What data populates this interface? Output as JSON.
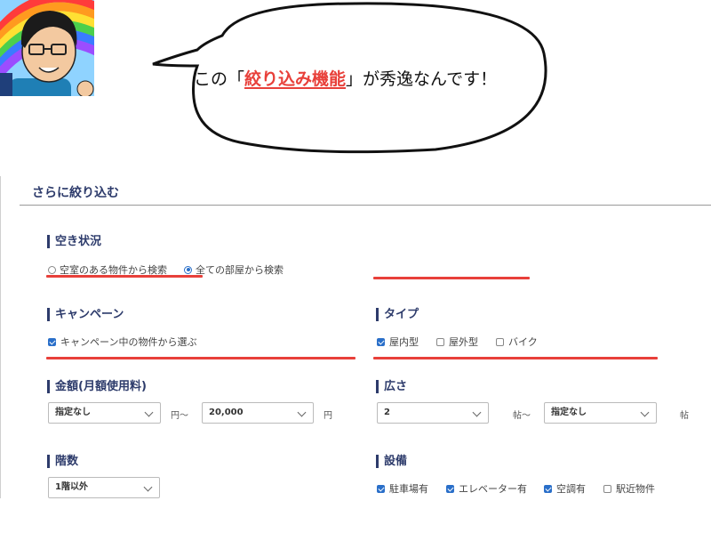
{
  "bubble": {
    "before": "この「",
    "highlight": "絞り込み機能",
    "after": "」が秀逸なんです！"
  },
  "panel": {
    "title": "さらに絞り込む",
    "vacancy": {
      "label": "空き状況",
      "options": [
        {
          "label": "空室のある物件から検索",
          "selected": false
        },
        {
          "label": "全ての部屋から検索",
          "selected": true
        }
      ]
    },
    "campaign": {
      "label": "キャンペーン",
      "options": [
        {
          "label": "キャンペーン中の物件から選ぶ",
          "checked": true
        }
      ]
    },
    "type": {
      "label": "タイプ",
      "options": [
        {
          "label": "屋内型",
          "checked": true
        },
        {
          "label": "屋外型",
          "checked": false
        },
        {
          "label": "バイク",
          "checked": false
        }
      ]
    },
    "price": {
      "label": "金額(月額使用料)",
      "min": "指定なし",
      "min_unit": "円～",
      "max": "20,000",
      "max_unit": "円"
    },
    "size": {
      "label": "広さ",
      "min": "2",
      "min_unit": "帖～",
      "max": "指定なし",
      "max_unit": "帖"
    },
    "floor": {
      "label": "階数",
      "value": "1階以外"
    },
    "equipment": {
      "label": "設備",
      "options": [
        {
          "label": "駐車場有",
          "checked": true
        },
        {
          "label": "エレベーター有",
          "checked": true
        },
        {
          "label": "空調有",
          "checked": true
        },
        {
          "label": "駅近物件",
          "checked": false
        }
      ]
    }
  },
  "colors": {
    "accent": "#2a6fc9",
    "heading": "#2d3b6b",
    "annotation_red": "#e8403a"
  }
}
